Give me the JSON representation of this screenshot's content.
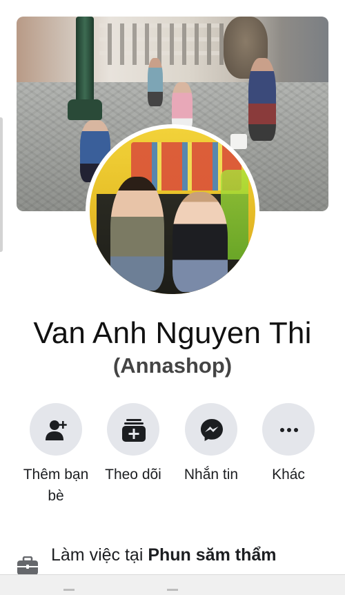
{
  "profile": {
    "name": "Van Anh Nguyen Thi",
    "alternate_name": "(Annashop)"
  },
  "actions": [
    {
      "label": "Thêm bạn bè",
      "icon": "add-friend-icon"
    },
    {
      "label": "Theo dõi",
      "icon": "follow-icon"
    },
    {
      "label": "Nhắn tin",
      "icon": "messenger-icon"
    },
    {
      "label": "Khác",
      "icon": "more-icon"
    }
  ],
  "work": {
    "prefix": "Làm việc tại ",
    "place": "Phun săm thẩm",
    "icon": "briefcase-icon"
  },
  "colors": {
    "button_bg": "#e4e6eb",
    "text": "#1c1e21"
  }
}
